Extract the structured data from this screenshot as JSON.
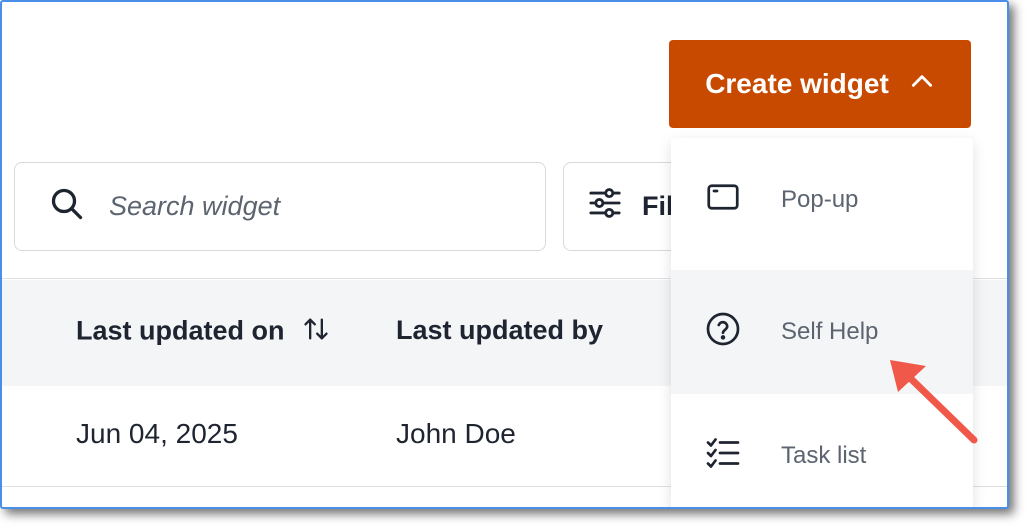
{
  "header": {
    "create_button_label": "Create widget"
  },
  "search": {
    "placeholder": "Search widget"
  },
  "filter": {
    "label": "Fil"
  },
  "table": {
    "columns": [
      {
        "label": "Last updated on",
        "sortable": true
      },
      {
        "label": "Last updated by"
      }
    ],
    "rows": [
      {
        "updated_on": "Jun 04, 2025",
        "updated_by": "John Doe"
      }
    ]
  },
  "dropdown": {
    "items": [
      {
        "label": "Pop-up",
        "icon": "window-icon"
      },
      {
        "label": "Self Help",
        "icon": "question-circle-icon",
        "highlighted": true
      },
      {
        "label": "Task list",
        "icon": "checklist-icon"
      }
    ]
  },
  "colors": {
    "primary_button": "#c84a00",
    "annotation_arrow": "#f0584a",
    "frame_border": "#4a8fe7"
  }
}
